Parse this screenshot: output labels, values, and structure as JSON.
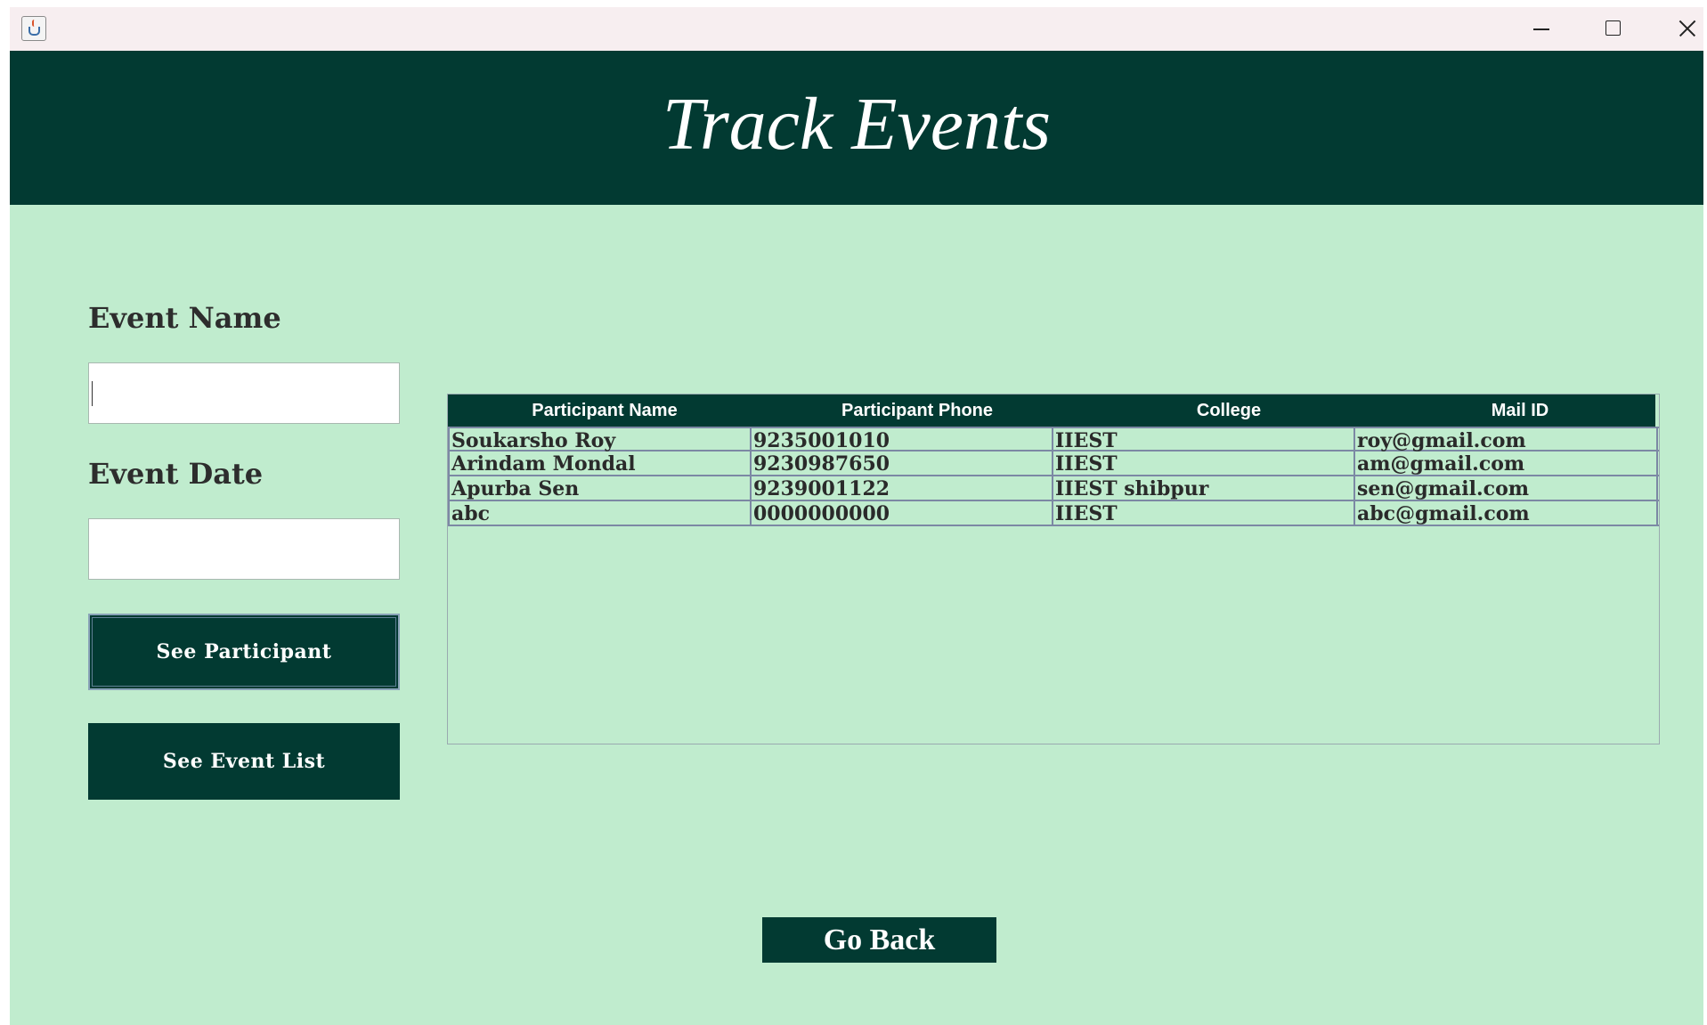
{
  "window": {
    "icon": "java-cup-icon",
    "controls": [
      "minimize-icon",
      "maximize-icon",
      "close-icon"
    ]
  },
  "header": {
    "title": "Track Events",
    "background": "#023a32"
  },
  "form": {
    "event_name_label": "Event Name",
    "event_name_value": "",
    "event_date_label": "Event Date",
    "event_date_value": "",
    "see_participant_label": "See Participant",
    "see_event_list_label": "See Event List"
  },
  "table": {
    "columns": [
      "Participant Name",
      "Participant Phone",
      "College",
      "Mail ID"
    ],
    "rows": [
      [
        "Soukarsho Roy",
        "9235001010",
        "IIEST",
        "roy@gmail.com"
      ],
      [
        "Arindam Mondal",
        "9230987650",
        "IIEST",
        "am@gmail.com"
      ],
      [
        "Apurba Sen",
        "9239001122",
        "IIEST shibpur",
        "sen@gmail.com"
      ],
      [
        "abc",
        "0000000000",
        "IIEST",
        "abc@gmail.com"
      ]
    ]
  },
  "footer": {
    "go_back_label": "Go Back"
  },
  "colors": {
    "background": "#c0ecce",
    "accent": "#023a32",
    "titlebar": "#f7eef0"
  }
}
